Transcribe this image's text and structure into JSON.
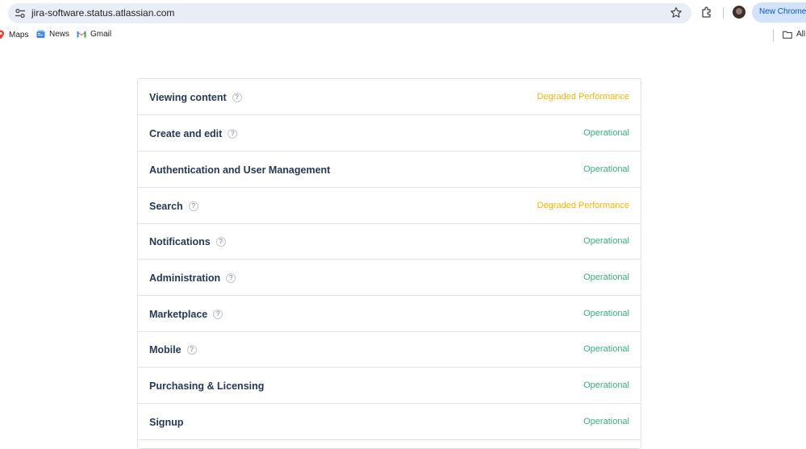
{
  "browser": {
    "url": "jira-software.status.atlassian.com",
    "new_chrome_label": "New Chrome a",
    "bookmarks": [
      {
        "label": "Maps",
        "icon": "maps-icon"
      },
      {
        "label": "News",
        "icon": "news-icon"
      },
      {
        "label": "Gmail",
        "icon": "gmail-icon"
      }
    ],
    "all_bookmarks_label": "All"
  },
  "colors": {
    "operational": "#36b37e",
    "degraded": "#ffb400",
    "heading": "#253858",
    "border": "#e1e3e8"
  },
  "components": [
    {
      "name": "Viewing content",
      "help": "?",
      "has_help": true,
      "status": "Degraded Performance",
      "state": "degraded"
    },
    {
      "name": "Create and edit",
      "help": "?",
      "has_help": true,
      "status": "Operational",
      "state": "operational"
    },
    {
      "name": "Authentication and User Management",
      "help": "",
      "has_help": false,
      "status": "Operational",
      "state": "operational"
    },
    {
      "name": "Search",
      "help": "?",
      "has_help": true,
      "status": "Degraded Performance",
      "state": "degraded"
    },
    {
      "name": "Notifications",
      "help": "?",
      "has_help": true,
      "status": "Operational",
      "state": "operational"
    },
    {
      "name": "Administration",
      "help": "?",
      "has_help": true,
      "status": "Operational",
      "state": "operational"
    },
    {
      "name": "Marketplace",
      "help": "?",
      "has_help": true,
      "status": "Operational",
      "state": "operational"
    },
    {
      "name": "Mobile",
      "help": "?",
      "has_help": true,
      "status": "Operational",
      "state": "operational"
    },
    {
      "name": "Purchasing & Licensing",
      "help": "",
      "has_help": false,
      "status": "Operational",
      "state": "operational"
    },
    {
      "name": "Signup",
      "help": "",
      "has_help": false,
      "status": "Operational",
      "state": "operational"
    }
  ]
}
